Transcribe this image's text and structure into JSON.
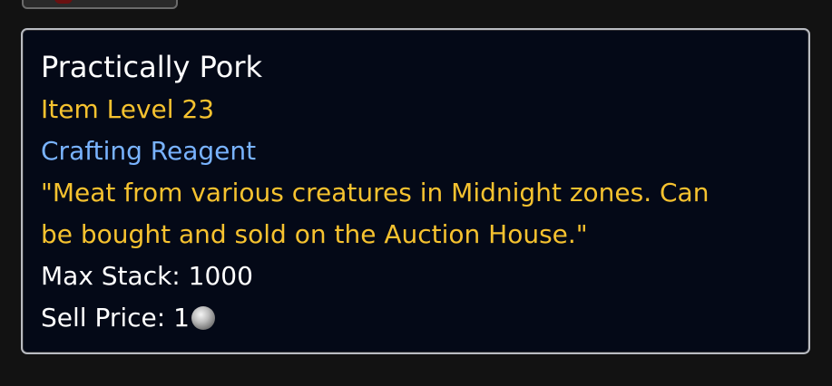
{
  "tooltip": {
    "name": "Practically Pork",
    "item_level": "Item Level 23",
    "type": "Crafting Reagent",
    "description_line1": "\"Meat from various creatures in Midnight zones. Can",
    "description_line2": "be bought and sold on the Auction House.\"",
    "max_stack": "Max Stack: 1000",
    "sell_price": "Sell Price: 1",
    "coin_icon": "silver-coin-icon"
  },
  "colors": {
    "background": "#121212",
    "tooltip_bg": "#040917",
    "tooltip_border": "#b9bcc2",
    "name": "#ffffff",
    "item_level": "#f6c22f",
    "item_type": "#79b3ff",
    "flavor_text": "#f6c22f",
    "info_text": "#ffffff"
  }
}
